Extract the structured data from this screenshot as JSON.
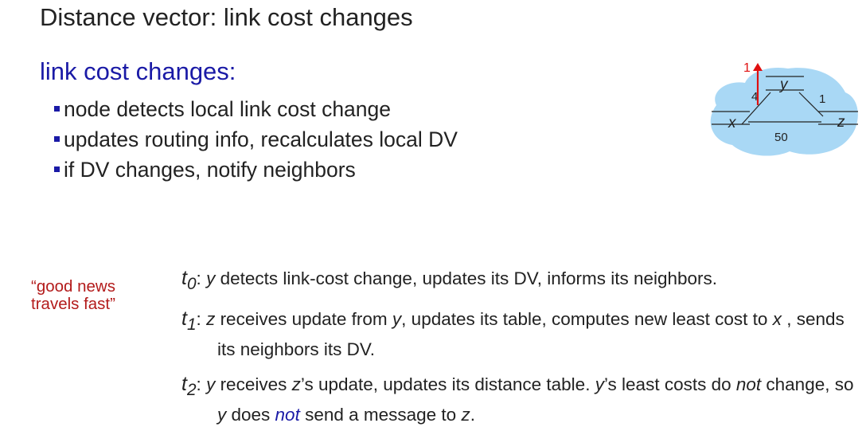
{
  "title": "Distance vector: link cost changes",
  "subhead": "link cost changes:",
  "bullets": [
    "node detects local link cost change",
    "updates routing info, recalculates local DV",
    "if DV changes, notify neighbors"
  ],
  "diagram": {
    "nodes": [
      "x",
      "y",
      "z"
    ],
    "links": [
      {
        "ends": "x-y",
        "cost": "4"
      },
      {
        "ends": "y-z",
        "cost": "1"
      },
      {
        "ends": "x-z",
        "cost": "50"
      }
    ],
    "changed_cost": "1",
    "cloud_color": "#a9d8f5",
    "change_color": "#e01010"
  },
  "callout": "“good news travels fast”",
  "events": [
    {
      "t": "t",
      "sub": "0",
      "parts": [
        {
          "text": ": ",
          "style": ""
        },
        {
          "text": "y",
          "style": "italic"
        },
        {
          "text": " detects link-cost change, updates its DV, informs its neighbors.",
          "style": ""
        }
      ]
    },
    {
      "t": "t",
      "sub": "1",
      "parts": [
        {
          "text": ": ",
          "style": ""
        },
        {
          "text": "z",
          "style": "italic"
        },
        {
          "text": " receives update from ",
          "style": ""
        },
        {
          "text": "y",
          "style": "italic"
        },
        {
          "text": ", updates its table, computes new least cost to ",
          "style": ""
        },
        {
          "text": "x",
          "style": "italic"
        },
        {
          "text": " , sends its neighbors its DV.",
          "style": ""
        }
      ]
    },
    {
      "t": "t",
      "sub": "2",
      "parts": [
        {
          "text": ": ",
          "style": ""
        },
        {
          "text": "y",
          "style": "italic"
        },
        {
          "text": " receives ",
          "style": ""
        },
        {
          "text": "z",
          "style": "italic"
        },
        {
          "text": "’s update, updates its distance table.  ",
          "style": ""
        },
        {
          "text": "y",
          "style": "italic"
        },
        {
          "text": "’s least costs do ",
          "style": ""
        },
        {
          "text": "not",
          "style": "italic"
        },
        {
          "text": " change, so ",
          "style": ""
        },
        {
          "text": "y",
          "style": "italic"
        },
        {
          "text": " does ",
          "style": ""
        },
        {
          "text": "not",
          "style": "italic-blue"
        },
        {
          "text": " send a message to ",
          "style": ""
        },
        {
          "text": "z",
          "style": "italic"
        },
        {
          "text": ".",
          "style": ""
        }
      ]
    }
  ]
}
